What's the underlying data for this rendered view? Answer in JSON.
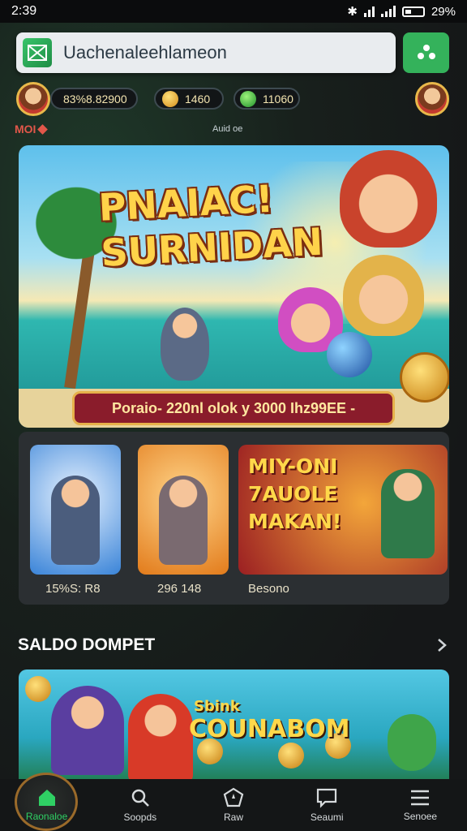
{
  "status_bar": {
    "time": "2:39",
    "battery": "29%"
  },
  "search": {
    "value": "Uachenaleehlameon"
  },
  "currency": {
    "balance": "83%8.82900",
    "bolts": "1460",
    "gems": "11060",
    "level_label": "MOI",
    "center_label": "Auid oe"
  },
  "hero": {
    "title_line1": "PNAIAC!",
    "title_line2": "SURNIDAN",
    "promo_text": "Poraio- 220nl olok y 3000 Ihz99EE -"
  },
  "games": [
    {
      "label": "15%S: R8"
    },
    {
      "label": "296 148"
    },
    {
      "title": "MIY-ONI 7AUOLE MAKAN!",
      "label": "Besono"
    }
  ],
  "section": {
    "title": "SALDO DOMPET"
  },
  "banner": {
    "small": "Sbink",
    "big": "COUNABOM"
  },
  "nav": [
    {
      "label": "Raonaloe",
      "icon": "home-icon",
      "active": true
    },
    {
      "label": "Soopds",
      "icon": "search-icon"
    },
    {
      "label": "Raw",
      "icon": "compass-icon"
    },
    {
      "label": "Seaumi",
      "icon": "chat-icon"
    },
    {
      "label": "Senoee",
      "icon": "menu-icon"
    }
  ],
  "colors": {
    "accent": "#34b25b",
    "gold": "#ffd34a",
    "promo": "#8a1c2b"
  }
}
